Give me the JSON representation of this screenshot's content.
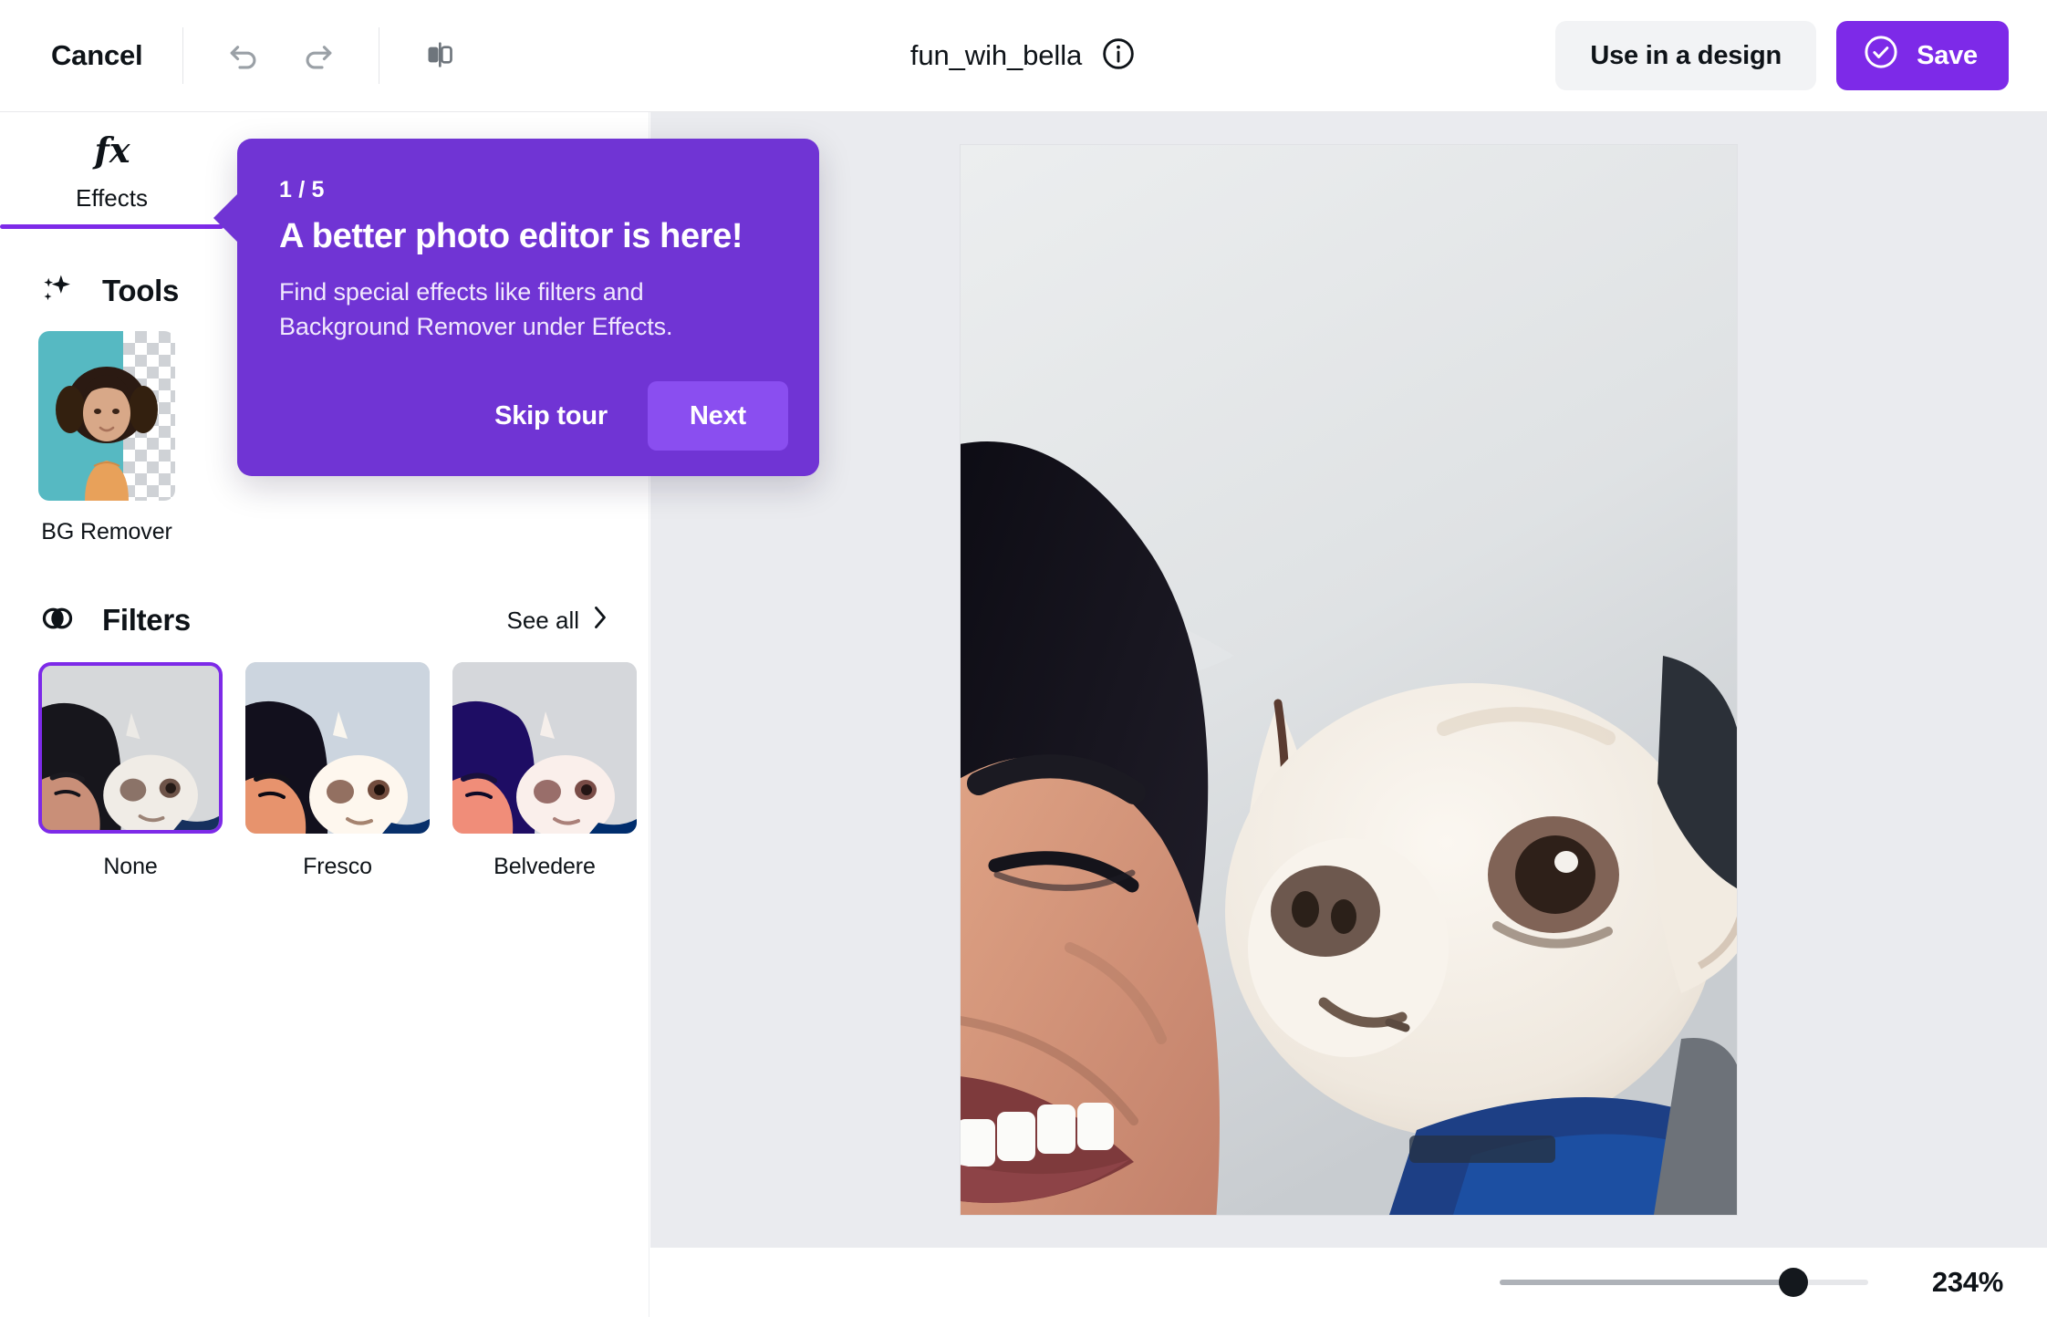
{
  "header": {
    "cancel_label": "Cancel",
    "undo_icon": "undo-icon",
    "redo_icon": "redo-icon",
    "compare_icon": "compare-split-icon",
    "title": "fun_wih_bella",
    "info_icon": "info-icon",
    "use_in_design_label": "Use in a design",
    "save_label": "Save",
    "save_icon": "check-circle-icon",
    "accent_color": "#7d2ae8",
    "secondary_button_bg": "#f2f3f5"
  },
  "sidebar": {
    "tabs": [
      {
        "label": "Effects",
        "icon": "fx-icon",
        "selected": true
      }
    ],
    "tools": {
      "title": "Tools",
      "icon": "sparkle-icon",
      "items": [
        {
          "label": "BG Remover",
          "thumbnail": "bg-remover-thumbnail"
        }
      ]
    },
    "filters": {
      "title": "Filters",
      "icon": "overlapping-circles-icon",
      "see_all_label": "See all",
      "see_all_icon": "chevron-right-icon",
      "items": [
        {
          "label": "None",
          "selected": true
        },
        {
          "label": "Fresco",
          "selected": false
        },
        {
          "label": "Belvedere",
          "selected": false
        },
        {
          "label": "",
          "selected": false
        }
      ]
    }
  },
  "tour_tooltip": {
    "step": "1 / 5",
    "title": "A better photo editor is here!",
    "body": "Find special effects like filters and Background Remover under Effects.",
    "skip_label": "Skip tour",
    "next_label": "Next",
    "background_color": "#7034d4",
    "next_button_color": "#8a4ef0"
  },
  "canvas": {
    "background_color": "#eaebef",
    "photo_alt": "Person smiling cheek-to-cheek with a white chihuahua wearing a blue harness"
  },
  "bottom_bar": {
    "zoom_value": "234%",
    "zoom_percent": 76
  }
}
